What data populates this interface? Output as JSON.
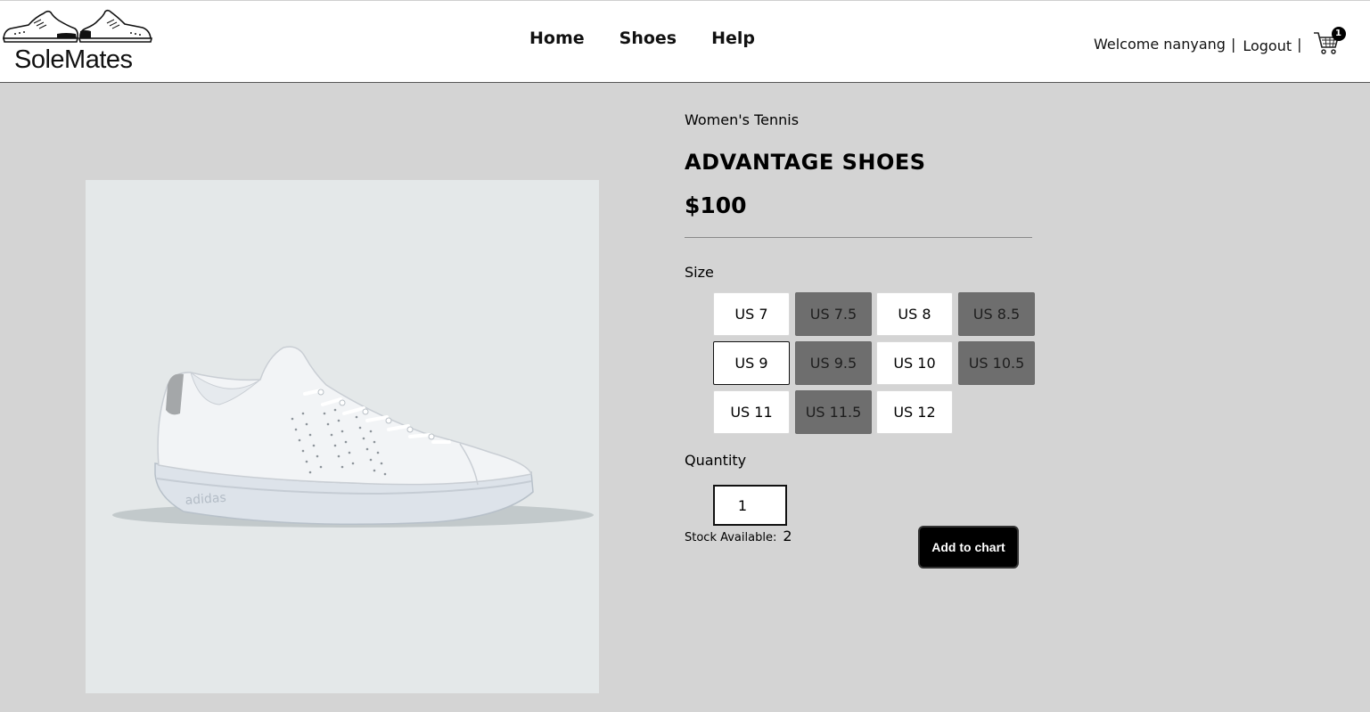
{
  "header": {
    "logo_text": "SoleMates",
    "nav": [
      {
        "label": "Home"
      },
      {
        "label": "Shoes"
      },
      {
        "label": "Help"
      }
    ],
    "welcome": "Welcome nanyang",
    "separator": "|",
    "logout": "Logout",
    "cart_count": "1",
    "cart_icon": "cart-icon"
  },
  "product": {
    "image_icon": "white-sneaker-image",
    "category": "Women's Tennis",
    "title": "ADVANTAGE SHOES",
    "price": "$100",
    "size_label": "Size",
    "sizes": [
      {
        "label": "US 7",
        "available": true
      },
      {
        "label": "US 7.5",
        "available": false
      },
      {
        "label": "US 8",
        "available": true
      },
      {
        "label": "US 8.5",
        "available": false
      },
      {
        "label": "US 9",
        "available": true,
        "selected": true
      },
      {
        "label": "US 9.5",
        "available": false
      },
      {
        "label": "US 10",
        "available": true
      },
      {
        "label": "US 10.5",
        "available": false
      },
      {
        "label": "US 11",
        "available": true
      },
      {
        "label": "US 11.5",
        "available": false
      },
      {
        "label": "US 12",
        "available": true
      }
    ],
    "quantity_label": "Quantity",
    "quantity_value": "1",
    "stock_label": "Stock Available:",
    "stock_value": "2",
    "add_button": "Add to chart"
  },
  "colors": {
    "background": "#d4d4d4",
    "header": "#ffffff",
    "unavailable_size": "#6e6e6e",
    "button": "#000000"
  }
}
